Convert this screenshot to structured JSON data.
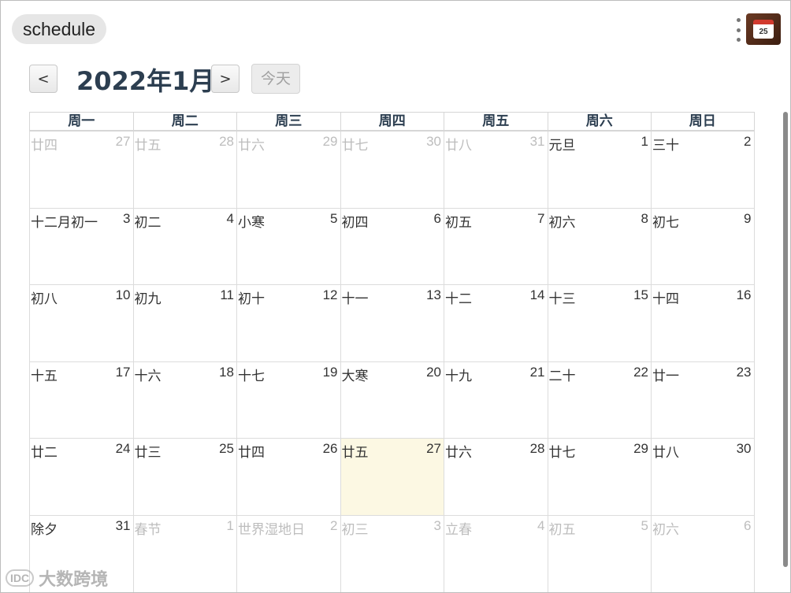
{
  "app": {
    "title": "schedule",
    "icon_text": "25"
  },
  "toolbar": {
    "prev_label": "<",
    "next_label": ">",
    "month_title": "2022年1月",
    "today_label": "今天"
  },
  "calendar": {
    "weekdays": [
      "周一",
      "周二",
      "周三",
      "周四",
      "周五",
      "周六",
      "周日"
    ],
    "weeks": [
      [
        {
          "lunar": "廿四",
          "num": "27",
          "other": true
        },
        {
          "lunar": "廿五",
          "num": "28",
          "other": true
        },
        {
          "lunar": "廿六",
          "num": "29",
          "other": true
        },
        {
          "lunar": "廿七",
          "num": "30",
          "other": true
        },
        {
          "lunar": "廿八",
          "num": "31",
          "other": true
        },
        {
          "lunar": "元旦",
          "num": "1",
          "other": false
        },
        {
          "lunar": "三十",
          "num": "2",
          "other": false
        }
      ],
      [
        {
          "lunar": "十二月初一",
          "num": "3",
          "other": false
        },
        {
          "lunar": "初二",
          "num": "4",
          "other": false
        },
        {
          "lunar": "小寒",
          "num": "5",
          "other": false
        },
        {
          "lunar": "初四",
          "num": "6",
          "other": false
        },
        {
          "lunar": "初五",
          "num": "7",
          "other": false
        },
        {
          "lunar": "初六",
          "num": "8",
          "other": false
        },
        {
          "lunar": "初七",
          "num": "9",
          "other": false
        }
      ],
      [
        {
          "lunar": "初八",
          "num": "10",
          "other": false
        },
        {
          "lunar": "初九",
          "num": "11",
          "other": false
        },
        {
          "lunar": "初十",
          "num": "12",
          "other": false
        },
        {
          "lunar": "十一",
          "num": "13",
          "other": false
        },
        {
          "lunar": "十二",
          "num": "14",
          "other": false
        },
        {
          "lunar": "十三",
          "num": "15",
          "other": false
        },
        {
          "lunar": "十四",
          "num": "16",
          "other": false
        }
      ],
      [
        {
          "lunar": "十五",
          "num": "17",
          "other": false
        },
        {
          "lunar": "十六",
          "num": "18",
          "other": false
        },
        {
          "lunar": "十七",
          "num": "19",
          "other": false
        },
        {
          "lunar": "大寒",
          "num": "20",
          "other": false
        },
        {
          "lunar": "十九",
          "num": "21",
          "other": false
        },
        {
          "lunar": "二十",
          "num": "22",
          "other": false
        },
        {
          "lunar": "廿一",
          "num": "23",
          "other": false
        }
      ],
      [
        {
          "lunar": "廿二",
          "num": "24",
          "other": false
        },
        {
          "lunar": "廿三",
          "num": "25",
          "other": false
        },
        {
          "lunar": "廿四",
          "num": "26",
          "other": false
        },
        {
          "lunar": "廿五",
          "num": "27",
          "other": false,
          "today": true
        },
        {
          "lunar": "廿六",
          "num": "28",
          "other": false
        },
        {
          "lunar": "廿七",
          "num": "29",
          "other": false
        },
        {
          "lunar": "廿八",
          "num": "30",
          "other": false
        }
      ],
      [
        {
          "lunar": "除夕",
          "num": "31",
          "other": false
        },
        {
          "lunar": "春节",
          "num": "1",
          "other": true
        },
        {
          "lunar": "世界湿地日",
          "num": "2",
          "other": true
        },
        {
          "lunar": "初三",
          "num": "3",
          "other": true
        },
        {
          "lunar": "立春",
          "num": "4",
          "other": true
        },
        {
          "lunar": "初五",
          "num": "5",
          "other": true
        },
        {
          "lunar": "初六",
          "num": "6",
          "other": true
        }
      ]
    ]
  },
  "watermark": {
    "logo_text": "IDC",
    "text": "大数跨境"
  },
  "colors": {
    "title_text": "#2c3e50",
    "today_bg": "#fcf8e3",
    "muted_text": "#bdbdbd"
  }
}
